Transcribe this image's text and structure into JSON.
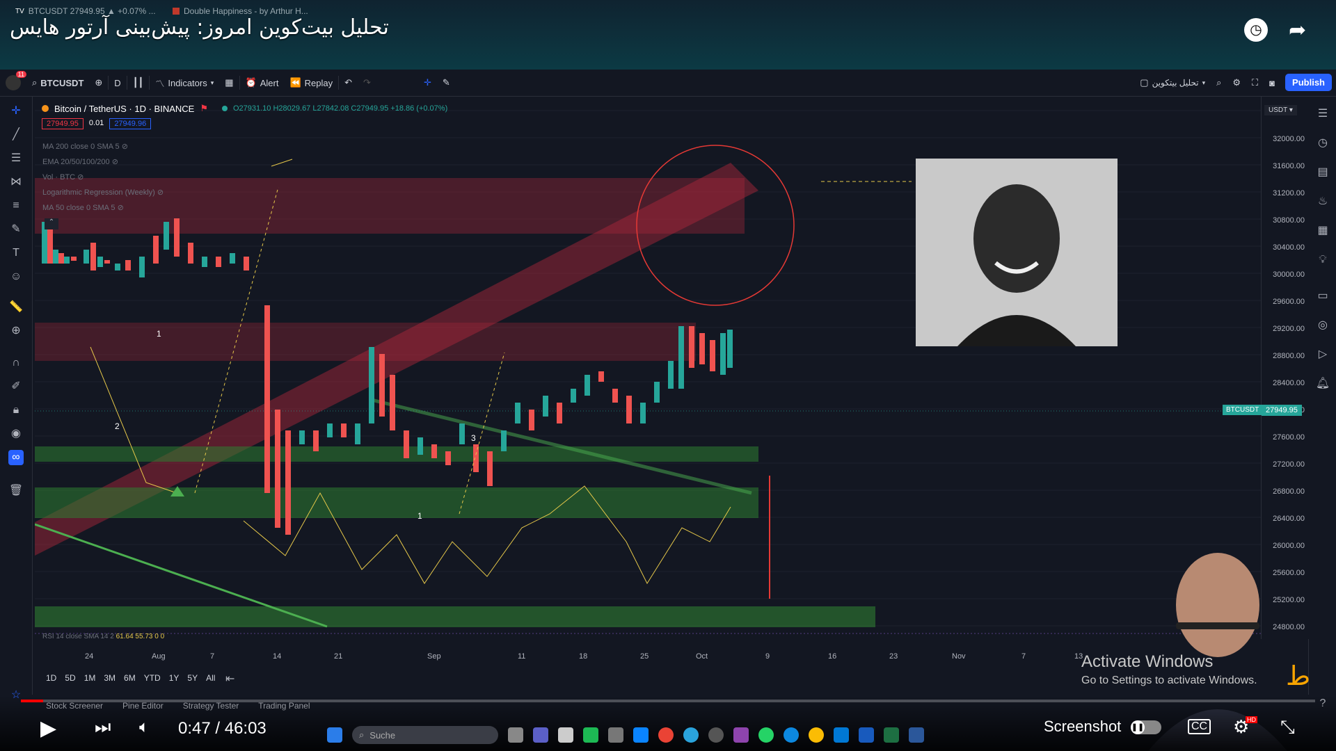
{
  "browser": {
    "tabs": [
      {
        "label": "BTCUSDT 27949.95 ▲ +0.07% ..."
      },
      {
        "label": "Double Happiness - by Arthur H..."
      }
    ]
  },
  "video": {
    "title": "تحلیل بیت‌کوین امروز: پیش‌بینی آرتور هایس",
    "time_current": "0:47",
    "time_total": "46:03",
    "time_display": "0:47 / 46:03",
    "screenshot_label": "Screenshot",
    "progress_fraction": 0.017
  },
  "toolbar": {
    "symbol": "BTCUSDT",
    "interval": "D",
    "indicators": "Indicators",
    "alert": "Alert",
    "replay": "Replay",
    "layout_name": "تحلیل بیتکوین",
    "publish": "Publish",
    "notification_count": "11"
  },
  "legend": {
    "title": "Bitcoin / TetherUS · 1D · BINANCE",
    "ohlc": "O27931.10 H28029.67 L27842.08 C27949.95 +18.86 (+0.07%)",
    "bid": "27949.95",
    "spread": "0.01",
    "ask": "27949.96",
    "indicators": [
      "MA 200 close 0 SMA 5",
      "EMA 20/50/100/200",
      "Vol · BTC",
      "Logarithmic Regression (Weekly)",
      "MA 50 close 0 SMA 5"
    ],
    "rsi": "RSI 14 close SMA 14 2",
    "rsi_values": "61.64  55.73  0  0"
  },
  "price_axis": {
    "currency": "USDT",
    "ticks": [
      "32000.00",
      "31600.00",
      "31200.00",
      "30800.00",
      "30400.00",
      "30000.00",
      "29600.00",
      "29200.00",
      "28800.00",
      "28400.00",
      "28000.00",
      "27600.00",
      "27200.00",
      "26800.00",
      "26400.00",
      "26000.00",
      "25600.00",
      "25200.00",
      "24800.00"
    ],
    "last_price_label": "BTCUSDT",
    "last_price": "27949.95"
  },
  "time_axis": {
    "ticks": [
      "24",
      "Aug",
      "7",
      "14",
      "21",
      "Sep",
      "11",
      "18",
      "25",
      "Oct",
      "9",
      "16",
      "23",
      "Nov",
      "7",
      "13"
    ]
  },
  "chart_labels": {
    "a": "1",
    "b": "2",
    "c": "3",
    "d": "1"
  },
  "timeframes": [
    "1D",
    "5D",
    "1M",
    "3M",
    "6M",
    "YTD",
    "1Y",
    "5Y",
    "All"
  ],
  "bottom_tabs": [
    "Stock Screener",
    "Pine Editor",
    "Strategy Tester",
    "Trading Panel"
  ],
  "activate": {
    "title": "Activate Windows",
    "sub": "Go to Settings to activate Windows."
  },
  "taskbar": {
    "search": "Suche"
  },
  "colors": {
    "bull": "#26a69a",
    "bear": "#ef5350",
    "accent": "#2962ff",
    "zone_red": "#b2283b",
    "zone_green": "#2e7d32"
  }
}
